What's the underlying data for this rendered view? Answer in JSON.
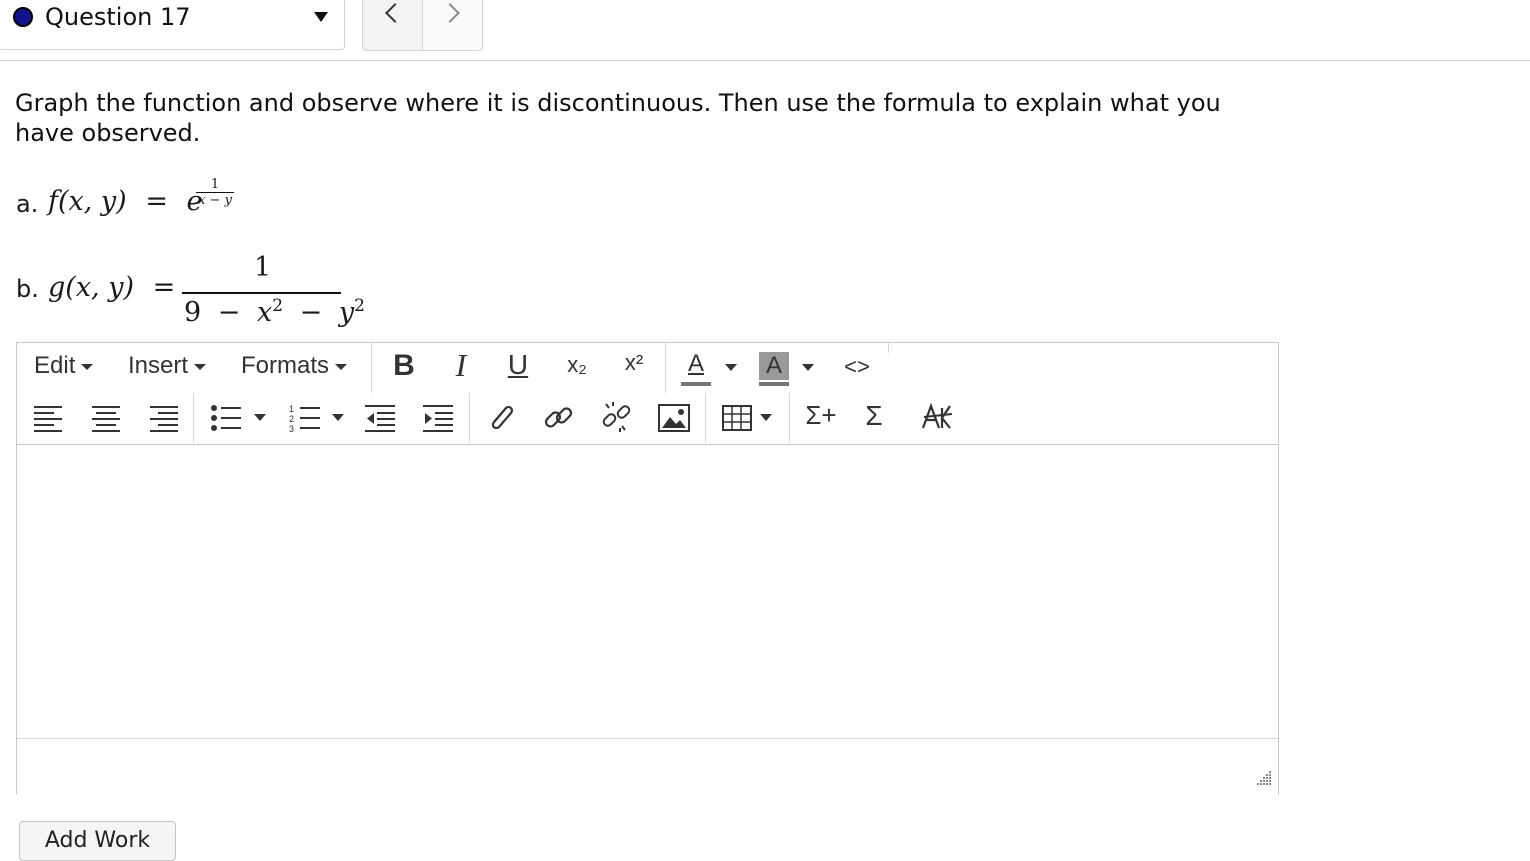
{
  "nav": {
    "question_label": "Question 17",
    "prev_label": "<",
    "next_label": ">"
  },
  "question": {
    "prompt": "Graph the function and observe where it is discontinuous. Then use the formula to explain what you have observed.",
    "part_a_label": "a.",
    "part_a_lhs": "f(x, y)",
    "part_a_eq": "=",
    "part_a_base": "e",
    "part_a_exp_num": "1",
    "part_a_exp_den": "x − y",
    "part_b_label": "b.",
    "part_b_lhs": "g(x, y)",
    "part_b_eq": "=",
    "part_b_num": "1",
    "part_b_den_9": "9",
    "part_b_den_minus1": "−",
    "part_b_den_x": "x",
    "part_b_den_minus2": "−",
    "part_b_den_y": "y",
    "part_b_den_exp": "2"
  },
  "editor": {
    "menus": [
      "Edit",
      "Insert",
      "Formats"
    ],
    "bold": "B",
    "italic": "I",
    "underline": "U",
    "subscript": "x₂",
    "superscript": "x²",
    "font_color": "A",
    "bg_color": "A",
    "code": "<>",
    "sum_plus": "Σ+",
    "sum": "Σ",
    "content": ""
  },
  "actions": {
    "add_work": "Add Work"
  },
  "colors": {
    "status_dot": "#12128a",
    "border": "#c8c8c8"
  }
}
